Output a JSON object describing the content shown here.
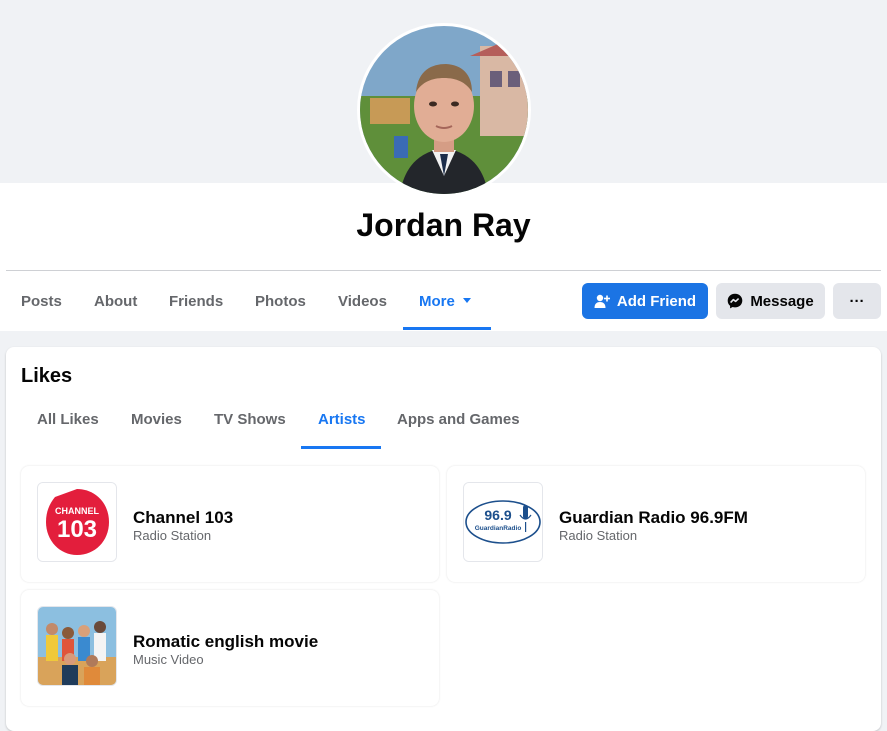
{
  "profile": {
    "name": "Jordan Ray"
  },
  "nav": {
    "tabs": [
      {
        "label": "Posts"
      },
      {
        "label": "About"
      },
      {
        "label": "Friends"
      },
      {
        "label": "Photos"
      },
      {
        "label": "Videos"
      },
      {
        "label": "More"
      }
    ],
    "active_tab": "More"
  },
  "actions": {
    "add_friend_label": "Add Friend",
    "message_label": "Message",
    "more_label": "···"
  },
  "likes": {
    "title": "Likes",
    "tabs": [
      {
        "label": "All Likes"
      },
      {
        "label": "Movies"
      },
      {
        "label": "TV Shows"
      },
      {
        "label": "Artists"
      },
      {
        "label": "Apps and Games"
      }
    ],
    "active_tab": "Artists",
    "items": [
      {
        "name": "Channel 103",
        "category": "Radio Station",
        "thumb_text": "CHANNEL",
        "thumb_number": "103"
      },
      {
        "name": "Guardian Radio 96.9FM",
        "category": "Radio Station",
        "thumb_number": "96.9",
        "thumb_text": "GuardianRadio"
      },
      {
        "name": "Romatic english movie",
        "category": "Music Video"
      }
    ]
  },
  "colors": {
    "accent": "#1877f2",
    "button_primary": "#1b74e4",
    "button_secondary": "#e4e6eb",
    "page_bg": "#f0f2f5",
    "channel103_red": "#e31e3c",
    "guardian_blue": "#1c4f8c"
  },
  "icons": {
    "add_friend": "person-plus-icon",
    "message": "messenger-icon",
    "dropdown": "caret-down-icon"
  }
}
